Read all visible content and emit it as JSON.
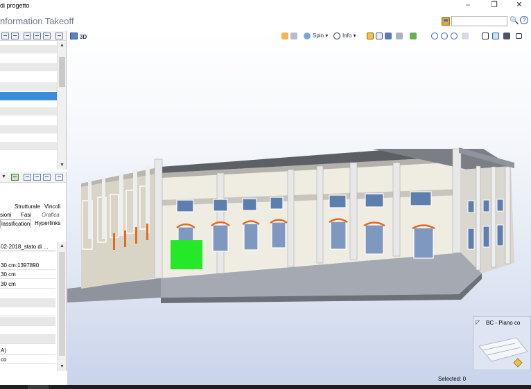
{
  "window": {
    "title": "di progetto",
    "minimize_glyph": "–",
    "restore_glyph": "❐",
    "close_glyph": "✕"
  },
  "header": {
    "app_title": "nformation Takeoff",
    "search_value": "",
    "help_glyph": "?"
  },
  "properties": {
    "tabs_row1": [
      "Strutturale",
      "Vincoli"
    ],
    "tabs_row2": [
      "sioni",
      "Fasi",
      "Grafica"
    ],
    "tabs_row3": [
      "lassification",
      "Hyperlinks"
    ],
    "header_value": "02-2018_stato di ...",
    "rows": [
      "30 cm:1397890",
      "30 cm",
      "30 cm",
      "",
      "",
      "",
      "",
      "",
      "",
      "A)",
      "co"
    ]
  },
  "viewport": {
    "mode_label": "3D",
    "spin_label": "Spin ▾",
    "info_label": "Info ▾",
    "minimap_title": "BC - Piano co",
    "selected_label": "Selected: 0"
  },
  "colors": {
    "accent": "#3a8ddb",
    "highlight_green": "#25e829",
    "orange_frames": "#e5681b"
  }
}
